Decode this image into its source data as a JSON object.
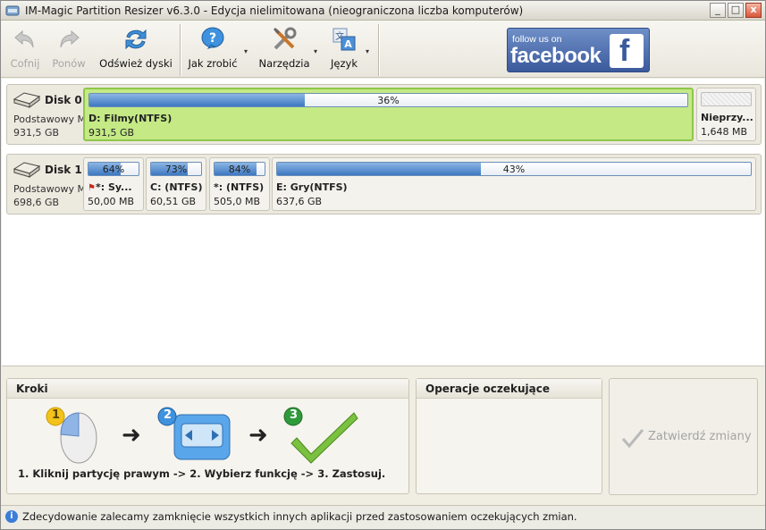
{
  "window": {
    "title": "IM-Magic Partition Resizer v6.3.0 - Edycja nielimitowana (nieograniczona liczba komputerów)",
    "minimize": "_",
    "maximize": "□",
    "close": "x"
  },
  "toolbar": {
    "undo_label": "Cofnij",
    "redo_label": "Ponów",
    "refresh_label": "Odśwież dyski",
    "howto_label": "Jak zrobić",
    "tools_label": "Narzędzia",
    "language_label": "Język",
    "dropdown_arrow": "▾",
    "facebook_small": "follow us on",
    "facebook_big": "facebook",
    "facebook_f": "f"
  },
  "disks": [
    {
      "name": "Disk 0",
      "type": "Podstawowy MBR",
      "size": "931,5 GB",
      "partitions": [
        {
          "usage": "36%",
          "usage_value": 36,
          "name": "D: Filmy(NTFS)",
          "size": "931,5 GB",
          "selected": true
        },
        {
          "usage": "",
          "usage_value": 0,
          "name": "Nieprzy...",
          "size": "1,648 MB",
          "unallocated": true
        }
      ]
    },
    {
      "name": "Disk 1",
      "type": "Podstawowy MBR",
      "size": "698,6 GB",
      "partitions": [
        {
          "usage": "64%",
          "usage_value": 64,
          "name": "*: Sy...",
          "size": "50,00 MB",
          "flag": true
        },
        {
          "usage": "73%",
          "usage_value": 73,
          "name": "C: (NTFS)",
          "size": "60,51 GB"
        },
        {
          "usage": "84%",
          "usage_value": 84,
          "name": "*: (NTFS)",
          "size": "505,0 MB"
        },
        {
          "usage": "43%",
          "usage_value": 43,
          "name": "E: Gry(NTFS)",
          "size": "637,6 GB"
        }
      ]
    }
  ],
  "steps": {
    "title": "Kroki",
    "caption": "1. Kliknij partycję prawym -> 2. Wybierz funkcję -> 3. Zastosuj.",
    "numbers": [
      "1",
      "2",
      "3"
    ],
    "arrow": "➜"
  },
  "pending": {
    "title": "Operacje oczekujące"
  },
  "apply": {
    "label": "Zatwierdź zmiany"
  },
  "status": {
    "icon": "i",
    "text": "Zdecydowanie zalecamy zamknięcie wszystkich innych aplikacji przed zastosowaniem oczekujących zmian."
  },
  "colors": {
    "selected_partition": "#c4e985",
    "usage_fill": "#3e78c1",
    "facebook": "#3b5a9c"
  }
}
